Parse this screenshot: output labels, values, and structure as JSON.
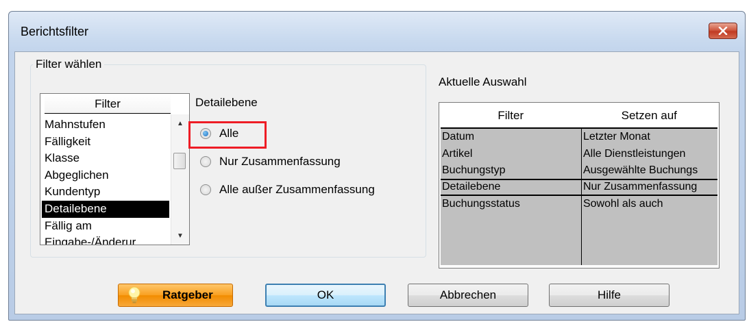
{
  "window": {
    "title": "Berichtsfilter"
  },
  "filter_group": {
    "legend": "Filter wählen",
    "list_header": "Filter",
    "items": [
      "Mahnstufen",
      "Fälligkeit",
      "Klasse",
      "Abgeglichen",
      "Kundentyp",
      "Detailebene",
      "Fällig am",
      "Eingabe-/Änderur"
    ],
    "selected": "Detailebene"
  },
  "detail": {
    "label": "Detailebene",
    "options": [
      "Alle",
      "Nur Zusammenfassung",
      "Alle außer Zusammenfassung"
    ],
    "selected": "Alle"
  },
  "current": {
    "label": "Aktuelle Auswahl",
    "headers": [
      "Filter",
      "Setzen auf"
    ],
    "rows": [
      {
        "filter": "Datum",
        "value": "Letzter Monat"
      },
      {
        "filter": "Artikel",
        "value": "Alle Dienstleistungen"
      },
      {
        "filter": "Buchungstyp",
        "value": "Ausgewählte Buchungs"
      },
      {
        "filter": "Detailebene",
        "value": "Nur Zusammenfassung"
      },
      {
        "filter": "Buchungsstatus",
        "value": "Sowohl als auch"
      }
    ]
  },
  "buttons": {
    "ratgeber": "Ratgeber",
    "ok": "OK",
    "cancel": "Abbrechen",
    "help": "Hilfe"
  },
  "colors": {
    "highlight": "#ee1c25",
    "ratgeber": "#f28c00",
    "selection": "#000000",
    "table_bg": "#c0c0c0"
  },
  "icons": {
    "close": "close-icon",
    "ratgeber": "lightbulb-icon"
  }
}
